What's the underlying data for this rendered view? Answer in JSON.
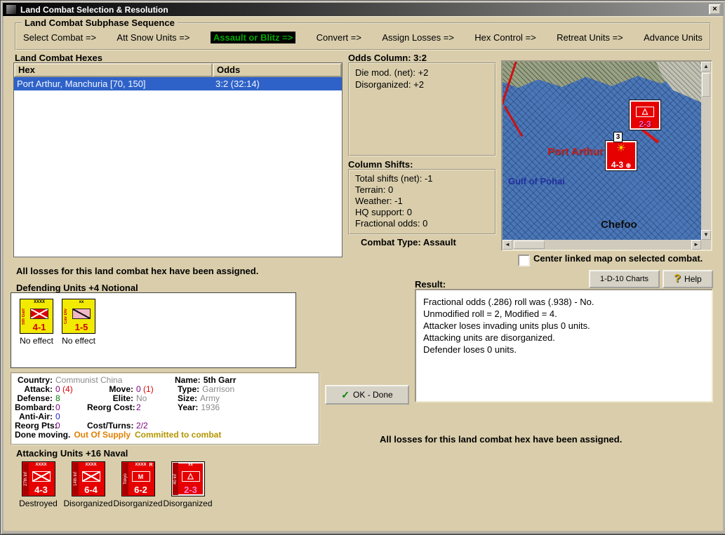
{
  "window": {
    "title": "Land Combat Selection & Resolution"
  },
  "sequence": {
    "title": "Land Combat Subphase Sequence",
    "active_index": 2,
    "steps": [
      {
        "label": "Select Combat =>"
      },
      {
        "label": "Att Snow Units =>"
      },
      {
        "label": "Assault or Blitz =>"
      },
      {
        "label": "Convert =>"
      },
      {
        "label": "Assign Losses =>"
      },
      {
        "label": "Hex Control =>"
      },
      {
        "label": "Retreat Units =>"
      },
      {
        "label": "Advance Units"
      }
    ]
  },
  "hexes": {
    "title": "Land Combat Hexes",
    "columns": {
      "hex": "Hex",
      "odds": "Odds"
    },
    "rows": [
      {
        "hex": "Port Arthur, Manchuria [70, 150]",
        "odds": "3:2 (32:14)"
      }
    ]
  },
  "odds_column": {
    "title": "Odds Column: 3:2",
    "lines": [
      "Die mod. (net): +2",
      "Disorganized: +2"
    ]
  },
  "column_shifts": {
    "title": "Column Shifts:",
    "lines": [
      "Total shifts (net): -1",
      "Terrain: 0",
      "Weather: -1",
      "HQ support: 0",
      "Fractional odds: 0"
    ]
  },
  "combat_type": "Combat Type: Assault",
  "map": {
    "port_label": "Port Arthur",
    "gulf_label": "Gulf of Pohai",
    "city_label": "Chefoo",
    "stack_marker": "3",
    "top_unit": {
      "strength": "2-3"
    },
    "mid_unit": {
      "strength": "4-3"
    }
  },
  "map_options": {
    "center_checkbox_label": "Center linked map on selected combat."
  },
  "buttons": {
    "charts": "1-D-10 Charts",
    "help": "Help",
    "ok_done": "OK - Done"
  },
  "messages": {
    "losses_assigned_left": "All losses for this land combat hex have been assigned.",
    "losses_assigned_right": "All losses for this land combat hex have been assigned."
  },
  "defending": {
    "title": "Defending Units +4 Notional",
    "units": [
      {
        "side": "5th Garr",
        "size": "XXXX",
        "symbol": "garrison-icon",
        "strength": "4-1",
        "status": "No effect"
      },
      {
        "side": "Cav Div",
        "size": "xx",
        "symbol": "cavalry-icon",
        "strength": "1-5",
        "status": "No effect"
      }
    ]
  },
  "detail": {
    "country_label": "Country:",
    "country": "Communist China",
    "name_label": "Name:",
    "name": "5th Garr",
    "attack_label": "Attack:",
    "attack": "0",
    "attack_extra": "(4)",
    "move_label": "Move:",
    "move": "0",
    "move_extra": "(1)",
    "type_label": "Type:",
    "type": "Garrison",
    "defense_label": "Defense:",
    "defense": "8",
    "elite_label": "Elite:",
    "elite": "No",
    "size_label": "Size:",
    "size": "Army",
    "bombard_label": "Bombard:",
    "bombard": "0",
    "reorg_cost_label": "Reorg Cost:",
    "reorg_cost": "2",
    "year_label": "Year:",
    "year": "1936",
    "antiair_label": "Anti-Air:",
    "antiair": "0",
    "reorg_pts_label": "Reorg Pts:",
    "reorg_pts": "0",
    "cost_turns_label": "Cost/Turns:",
    "cost_turns": "2/2",
    "status_moving": "Done moving.",
    "status_supply": "Out Of Supply",
    "status_committed": "Committed to combat"
  },
  "result": {
    "title": "Result:",
    "lines": [
      "Fractional odds (.286) roll was (.938)  - No.",
      "Unmodified roll = 2, Modified = 4.",
      "Attacker loses invading units plus 0 units.",
      "Attacking units are disorganized.",
      "Defender loses 0 units."
    ]
  },
  "attacking": {
    "title": "Attacking Units +16 Naval",
    "units": [
      {
        "side": "27th Inf",
        "size": "XXXX",
        "symbol": "infantry-icon",
        "strength": "4-3",
        "status": "Destroyed",
        "badge": ""
      },
      {
        "side": "14th Inf",
        "size": "XXXX",
        "symbol": "infantry-icon",
        "strength": "6-4",
        "status": "Disorganized",
        "badge": ""
      },
      {
        "side": "Tokyo",
        "size": "XXXX",
        "symbol": "militia-icon",
        "strength": "6-2",
        "status": "Disorganized",
        "badge": "R"
      },
      {
        "side": "40 Inf",
        "size": "xx",
        "symbol": "marine-icon",
        "strength": "2-3",
        "status": "Disorganized",
        "badge": "",
        "strength_class": "pink"
      }
    ]
  },
  "icons": {
    "close": "×",
    "check": "✓",
    "help": "?",
    "burst": "☀",
    "circle_plus": "⊕",
    "up": "▲",
    "down": "▼",
    "left": "◄",
    "right": "►"
  },
  "colors": {
    "background_tan": "#d9cdab",
    "selected_row": "#2f62c8",
    "active_step_bg": "#000000",
    "active_step_fg": "#00a800",
    "counter_red": "#e60000",
    "counter_yellow": "#f2ea00",
    "sea_blue": "#4a77b7"
  }
}
